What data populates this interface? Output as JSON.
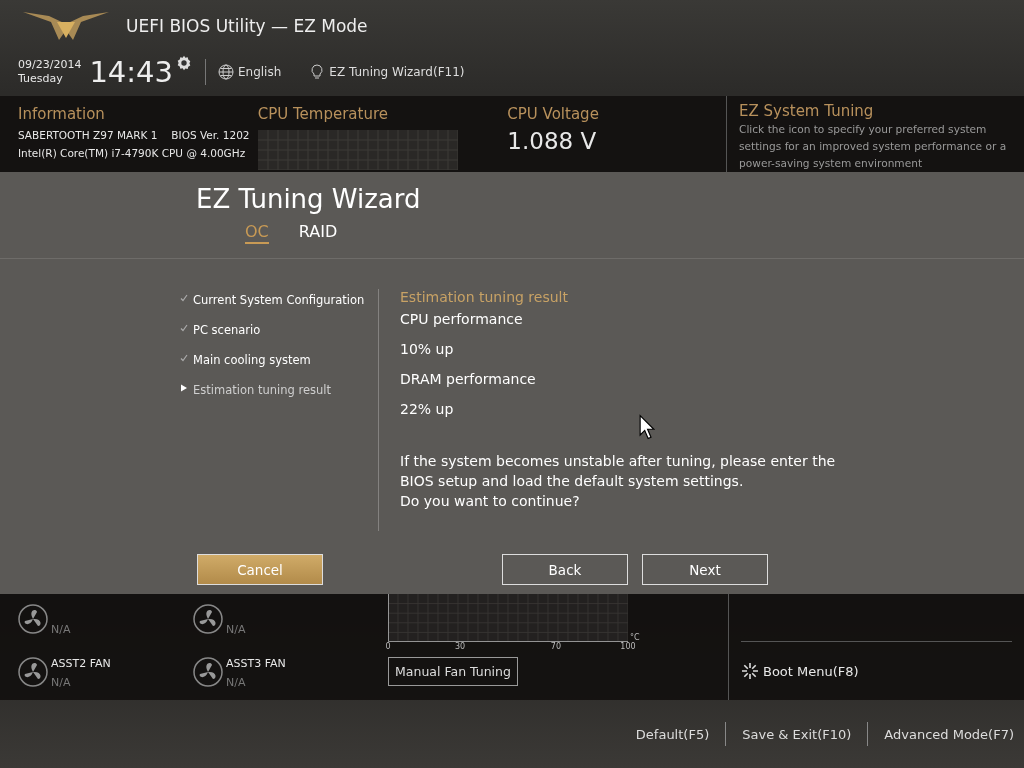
{
  "header": {
    "title": "UEFI BIOS Utility — EZ Mode",
    "date": "09/23/2014",
    "day": "Tuesday",
    "time": "14:43",
    "language": "English",
    "wizard_link": "EZ Tuning Wizard(F11)"
  },
  "information": {
    "heading": "Information",
    "board": "SABERTOOTH Z97 MARK 1",
    "bios": "BIOS Ver. 1202",
    "cpu": "Intel(R) Core(TM) i7-4790K CPU @ 4.00GHz"
  },
  "cpu_temperature": {
    "heading": "CPU Temperature"
  },
  "cpu_voltage": {
    "heading": "CPU Voltage",
    "value": "1.088 V"
  },
  "ez_system_tuning": {
    "heading": "EZ System Tuning",
    "description": "Click the icon to specify your preferred system settings for an improved system performance or a power-saving system environment"
  },
  "wizard": {
    "title": "EZ Tuning Wizard",
    "tabs": [
      {
        "label": "OC",
        "selected": true
      },
      {
        "label": "RAID",
        "selected": false
      }
    ],
    "steps": [
      {
        "label": "Current System Configuration",
        "kind": "done"
      },
      {
        "label": "PC scenario",
        "kind": "done"
      },
      {
        "label": "Main cooling system",
        "kind": "done"
      },
      {
        "label": "Estimation tuning result",
        "kind": "current"
      }
    ],
    "result_heading": "Estimation tuning result",
    "result_lines": [
      "CPU performance",
      "10% up",
      "DRAM performance",
      "22% up"
    ],
    "message": [
      "If the system becomes unstable after tuning, please enter the",
      "BIOS setup and load the default system settings.",
      "Do you want to continue?"
    ],
    "buttons": [
      {
        "label": "Cancel",
        "kind": "primary"
      },
      {
        "label": "Back",
        "kind": "outline"
      },
      {
        "label": "Next",
        "kind": "outline"
      }
    ]
  },
  "fans": [
    {
      "reading": "N/A"
    },
    {
      "reading": "N/A"
    },
    {
      "name": "ASST2 FAN",
      "reading": "N/A"
    },
    {
      "name": "ASST3 FAN",
      "reading": "N/A"
    }
  ],
  "fan_chart": {
    "x_ticks": [
      "0",
      "30",
      "70",
      "100"
    ],
    "unit": "°C",
    "button": "Manual Fan Tuning"
  },
  "boot_menu": "Boot Menu(F8)",
  "footer": [
    "Default(F5)",
    "Save & Exit(F10)",
    "Advanced Mode(F7)"
  ]
}
